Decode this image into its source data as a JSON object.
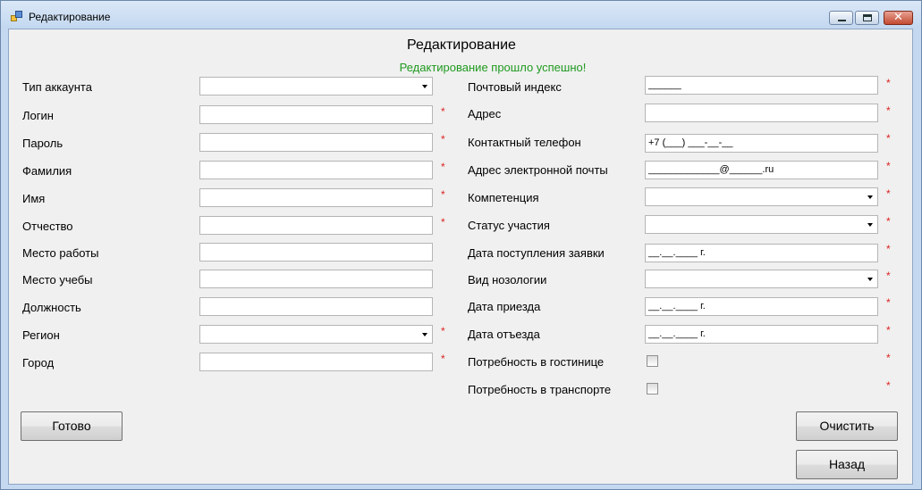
{
  "window": {
    "title": "Редактирование"
  },
  "heading": "Редактирование",
  "status_message": "Редактирование прошло успешно!",
  "required_mark": "*",
  "colors": {
    "success": "#1f9a1f",
    "required": "#dd2222",
    "titlebar": "#c3d8f0",
    "client": "#f0f0f0"
  },
  "left_fields": [
    {
      "label": "Тип аккаунта",
      "type": "combo",
      "value": ""
    },
    {
      "label": "Логин",
      "type": "text",
      "value": ""
    },
    {
      "label": "Пароль",
      "type": "text",
      "value": ""
    },
    {
      "label": "Фамилия",
      "type": "text",
      "value": ""
    },
    {
      "label": "Имя",
      "type": "text",
      "value": ""
    },
    {
      "label": "Отчество",
      "type": "text",
      "value": ""
    },
    {
      "label": "Место работы",
      "type": "text",
      "value": ""
    },
    {
      "label": "Место учебы",
      "type": "text",
      "value": ""
    },
    {
      "label": "Должность",
      "type": "text",
      "value": ""
    },
    {
      "label": "Регион",
      "type": "combo",
      "value": ""
    },
    {
      "label": "Город",
      "type": "text",
      "value": ""
    }
  ],
  "right_fields": [
    {
      "label": "Почтовый индекс",
      "type": "text",
      "value": "______"
    },
    {
      "label": "Адрес",
      "type": "text",
      "value": ""
    },
    {
      "label": "Контактный телефон",
      "type": "text",
      "value": "+7 (___) ___-__-__"
    },
    {
      "label": "Адрес электронной почты",
      "type": "text",
      "value": "_____________@______.ru"
    },
    {
      "label": "Компетенция",
      "type": "combo",
      "value": ""
    },
    {
      "label": "Статус участия",
      "type": "combo",
      "value": ""
    },
    {
      "label": "Дата поступления заявки",
      "type": "text",
      "value": "__.__.____ г."
    },
    {
      "label": "Вид нозологии",
      "type": "combo",
      "value": ""
    },
    {
      "label": "Дата приезда",
      "type": "text",
      "value": "__.__.____ г."
    },
    {
      "label": "Дата отъезда",
      "type": "text",
      "value": "__.__.____ г."
    },
    {
      "label": "Потребность в гостинице",
      "type": "checkbox",
      "checked": false
    },
    {
      "label": "Потребность в транспорте",
      "type": "checkbox",
      "checked": false
    }
  ],
  "buttons": {
    "done": "Готово",
    "clear": "Очистить",
    "back": "Назад"
  }
}
